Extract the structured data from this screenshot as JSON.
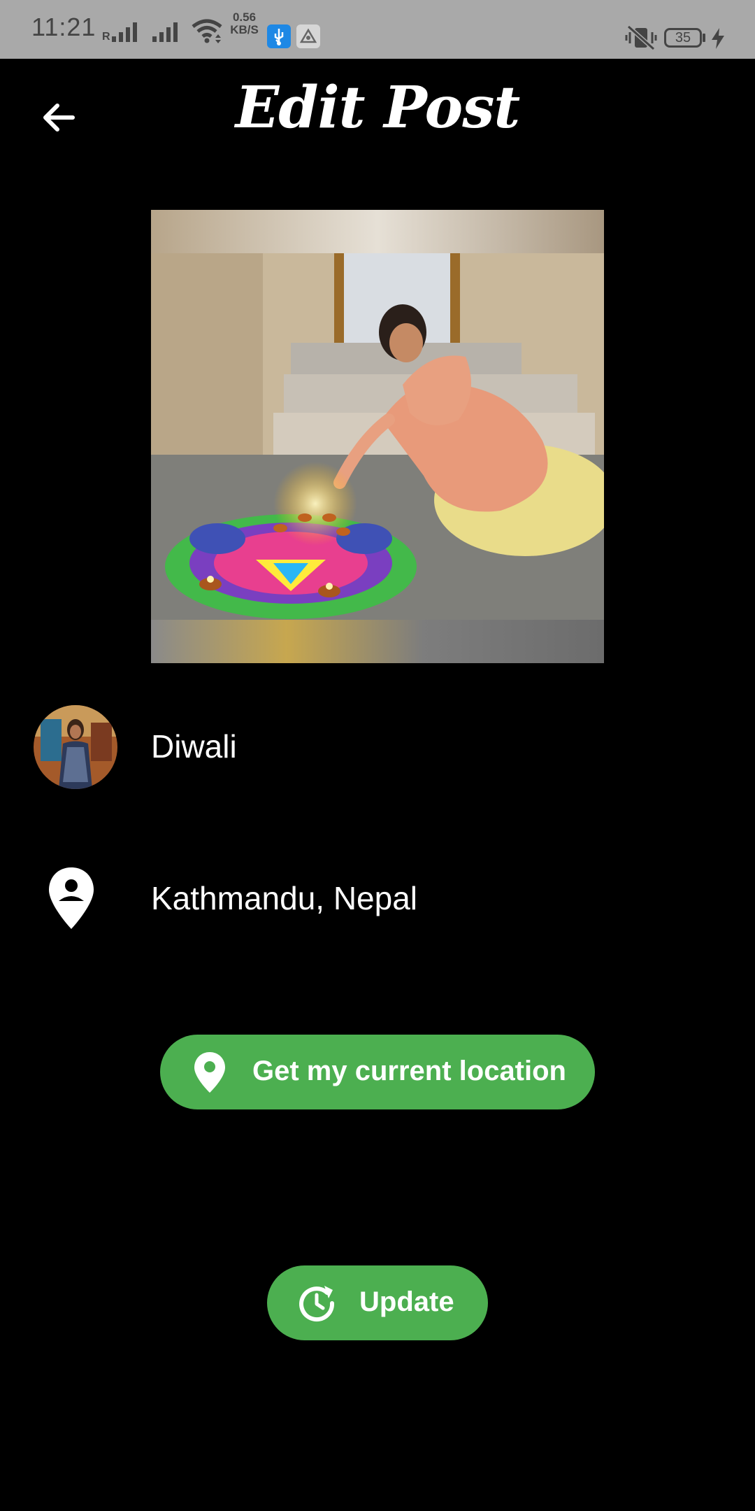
{
  "status_bar": {
    "time": "11:21",
    "network_speed_value": "0.56",
    "network_speed_unit": "KB/S",
    "roaming_mark": "R",
    "battery_level": "35",
    "icons": [
      "signal-icon",
      "signal-icon",
      "wifi-icon",
      "usb-icon",
      "app-icon",
      "vibrate-icon",
      "battery-icon",
      "charging-icon"
    ]
  },
  "app_bar": {
    "title": "Edit Post",
    "back_icon": "arrow-back-icon"
  },
  "post": {
    "caption": "Diwali",
    "location": "Kathmandu, Nepal"
  },
  "buttons": {
    "get_location_label": "Get my current location",
    "get_location_icon": "location-pin-icon",
    "update_label": "Update",
    "update_icon": "update-icon"
  },
  "colors": {
    "background": "#000000",
    "status_bar": "#a9a9a9",
    "accent_green": "#4caf50",
    "text": "#ffffff"
  }
}
